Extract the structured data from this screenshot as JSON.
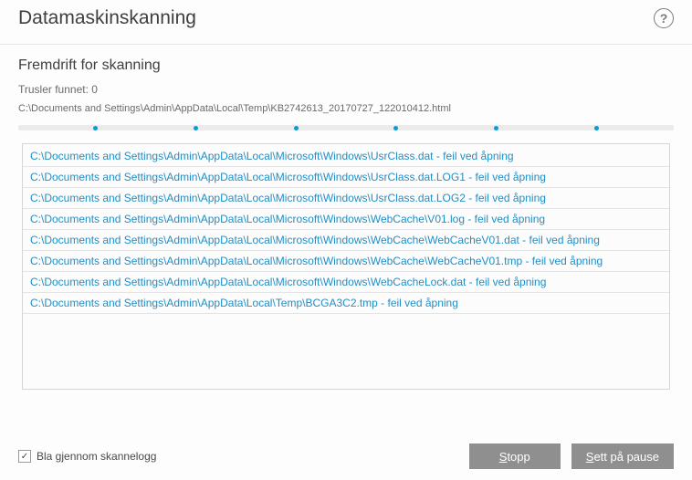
{
  "header": {
    "title": "Datamaskinskanning",
    "help_tooltip": "?"
  },
  "progress": {
    "subtitle": "Fremdrift for skanning",
    "threats_label": "Trusler funnet: 0",
    "current_file": "C:\\Documents and Settings\\Admin\\AppData\\Local\\Temp\\KB2742613_20170727_122010412.html"
  },
  "log": {
    "entries": [
      "C:\\Documents and Settings\\Admin\\AppData\\Local\\Microsoft\\Windows\\UsrClass.dat - feil ved åpning",
      "C:\\Documents and Settings\\Admin\\AppData\\Local\\Microsoft\\Windows\\UsrClass.dat.LOG1 - feil ved åpning",
      "C:\\Documents and Settings\\Admin\\AppData\\Local\\Microsoft\\Windows\\UsrClass.dat.LOG2 - feil ved åpning",
      "C:\\Documents and Settings\\Admin\\AppData\\Local\\Microsoft\\Windows\\WebCache\\V01.log - feil ved åpning",
      "C:\\Documents and Settings\\Admin\\AppData\\Local\\Microsoft\\Windows\\WebCache\\WebCacheV01.dat - feil ved åpning",
      "C:\\Documents and Settings\\Admin\\AppData\\Local\\Microsoft\\Windows\\WebCache\\WebCacheV01.tmp - feil ved åpning",
      "C:\\Documents and Settings\\Admin\\AppData\\Local\\Microsoft\\Windows\\WebCacheLock.dat - feil ved åpning",
      "C:\\Documents and Settings\\Admin\\AppData\\Local\\Temp\\BCGA3C2.tmp - feil ved åpning"
    ]
  },
  "footer": {
    "checkbox_label": "Bla gjennom skannelogg",
    "checkbox_checked": "✓",
    "stop_label": "Stopp",
    "stop_accel": "S",
    "pause_label": "Sett på pause",
    "pause_accel": "S"
  }
}
